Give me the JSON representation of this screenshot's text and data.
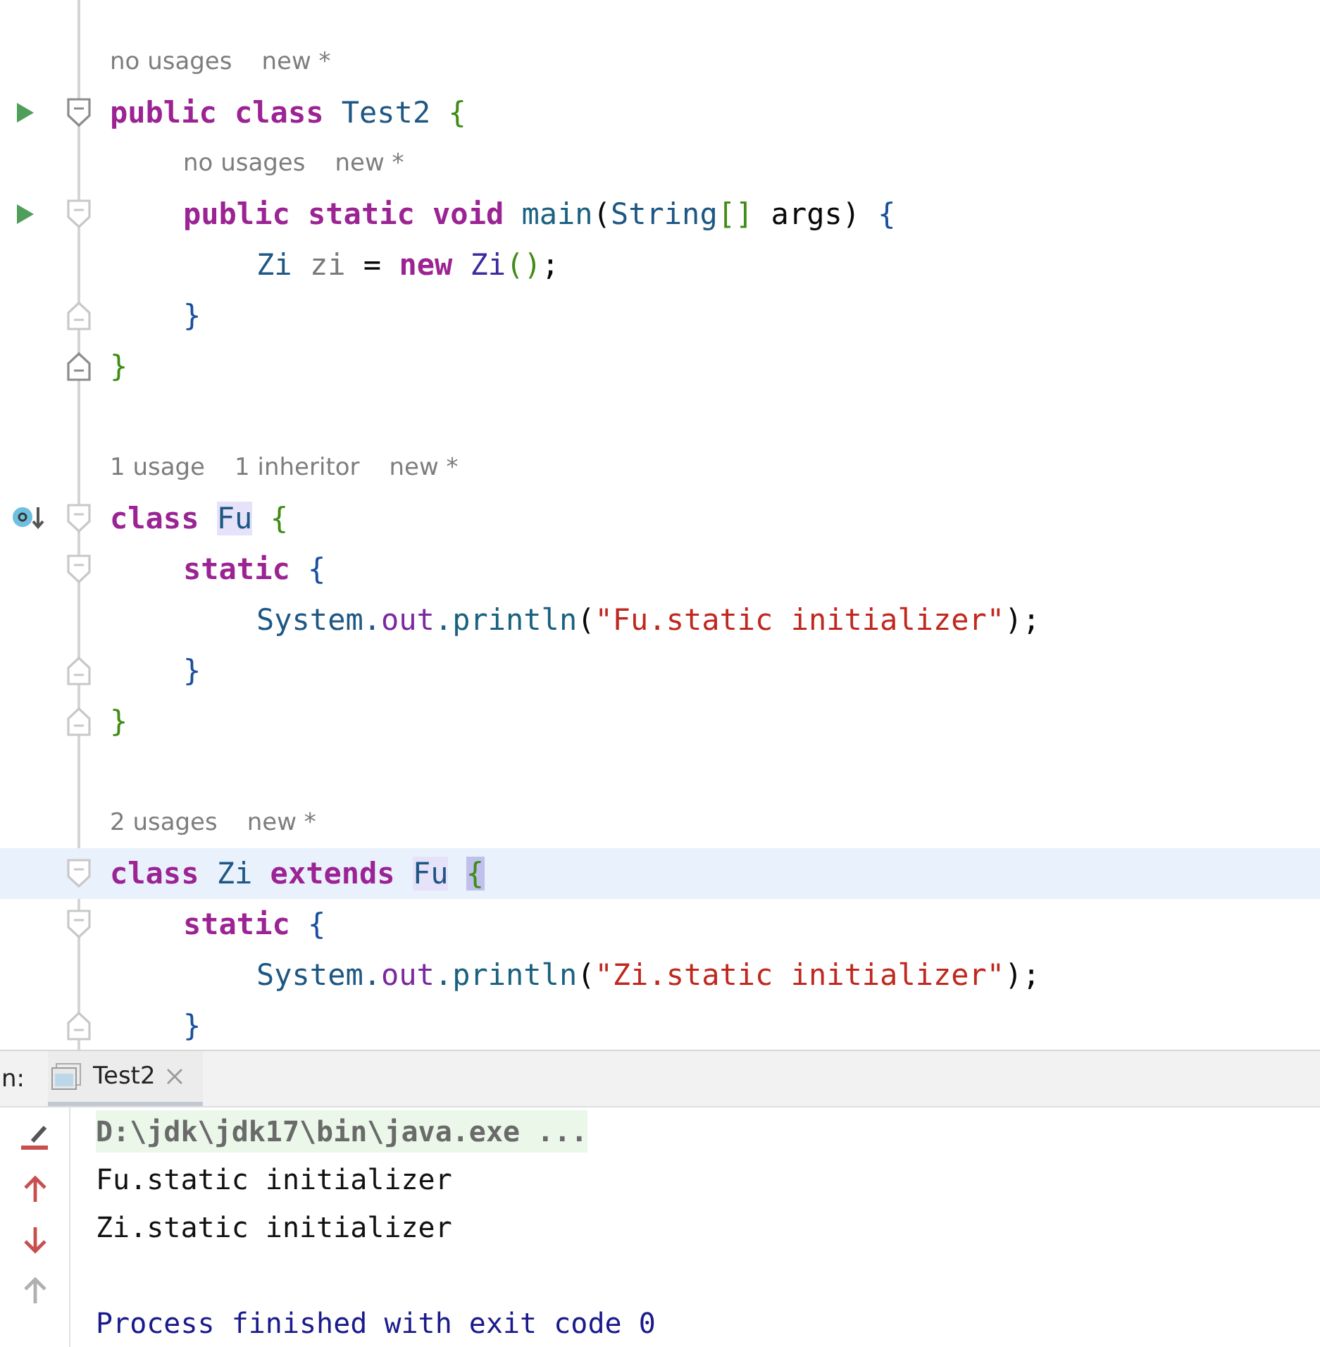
{
  "editor": {
    "items": [
      {
        "kind": "block",
        "hint": [
          "no usages",
          "new *"
        ],
        "runnable": true,
        "implemented": false,
        "current": false,
        "fold_active": true,
        "tokens": [
          {
            "t": "public ",
            "kind": "kw"
          },
          {
            "t": "class ",
            "kind": "kw"
          },
          {
            "t": "Test2 ",
            "kind": "type"
          },
          {
            "t": "{",
            "kind": "brace1"
          }
        ],
        "children": [
          {
            "kind": "block",
            "hint": [
              "no usages",
              "new *"
            ],
            "runnable": true,
            "implemented": false,
            "current": false,
            "fold_active": false,
            "tokens": [
              {
                "t": "public ",
                "kind": "kw"
              },
              {
                "t": "static ",
                "kind": "kw"
              },
              {
                "t": "void ",
                "kind": "kw"
              },
              {
                "t": "main",
                "kind": "method"
              },
              {
                "t": "(",
                "kind": "plain"
              },
              {
                "t": "String",
                "kind": "type"
              },
              {
                "t": "[]",
                "kind": "brace1"
              },
              {
                "t": " args",
                "kind": "plain"
              },
              {
                "t": ") ",
                "kind": "plain"
              },
              {
                "t": "{",
                "kind": "brace2"
              }
            ],
            "children": [
              {
                "kind": "statement",
                "current": false,
                "tokens": [
                  {
                    "t": "Zi ",
                    "kind": "type"
                  },
                  {
                    "t": "zi",
                    "kind": "unused"
                  },
                  {
                    "t": " = ",
                    "kind": "plain"
                  },
                  {
                    "t": "new ",
                    "kind": "kw"
                  },
                  {
                    "t": "Zi",
                    "kind": "type2"
                  },
                  {
                    "t": "(",
                    "kind": "brace1"
                  },
                  {
                    "t": ")",
                    "kind": "brace1"
                  },
                  {
                    "t": ";",
                    "kind": "plain"
                  }
                ]
              }
            ],
            "closer": [
              {
                "t": "}",
                "kind": "brace2"
              }
            ]
          }
        ],
        "closer": [
          {
            "t": "}",
            "kind": "brace1"
          }
        ]
      },
      {
        "kind": "blank"
      },
      {
        "kind": "block",
        "hint": [
          "1 usage",
          "1 inheritor",
          "new *"
        ],
        "runnable": false,
        "implemented": true,
        "current": false,
        "fold_active": false,
        "tokens": [
          {
            "t": "class ",
            "kind": "kw"
          },
          {
            "t": "Fu",
            "kind": "type",
            "usage_highlight": true
          },
          {
            "t": " {",
            "kind": "brace1"
          }
        ],
        "children": [
          {
            "kind": "block",
            "runnable": false,
            "implemented": false,
            "current": false,
            "fold_active": false,
            "tokens": [
              {
                "t": "static ",
                "kind": "kw"
              },
              {
                "t": "{",
                "kind": "brace2"
              }
            ],
            "children": [
              {
                "kind": "statement",
                "current": false,
                "tokens": [
                  {
                    "t": "System.",
                    "kind": "type"
                  },
                  {
                    "t": "out",
                    "kind": "field"
                  },
                  {
                    "t": ".println",
                    "kind": "method"
                  },
                  {
                    "t": "(",
                    "kind": "plain"
                  },
                  {
                    "t": "\"Fu.static initializer\"",
                    "kind": "str"
                  },
                  {
                    "t": ");",
                    "kind": "plain"
                  }
                ]
              }
            ],
            "closer": [
              {
                "t": "}",
                "kind": "brace2"
              }
            ]
          }
        ],
        "closer": [
          {
            "t": "}",
            "kind": "brace1"
          }
        ]
      },
      {
        "kind": "blank"
      },
      {
        "kind": "block",
        "hint": [
          "2 usages",
          "new *"
        ],
        "runnable": false,
        "implemented": false,
        "current": true,
        "fold_active": false,
        "tokens": [
          {
            "t": "class ",
            "kind": "kw"
          },
          {
            "t": "Zi ",
            "kind": "type"
          },
          {
            "t": "extends ",
            "kind": "kw"
          },
          {
            "t": "Fu",
            "kind": "type",
            "usage_highlight": true
          },
          {
            "t": " {",
            "kind": "brace1",
            "caret_match": true
          }
        ],
        "children": [
          {
            "kind": "block",
            "runnable": false,
            "implemented": false,
            "current": false,
            "fold_active": false,
            "tokens": [
              {
                "t": "static ",
                "kind": "kw"
              },
              {
                "t": "{",
                "kind": "brace2"
              }
            ],
            "children": [
              {
                "kind": "statement",
                "current": false,
                "tokens": [
                  {
                    "t": "System.",
                    "kind": "type"
                  },
                  {
                    "t": "out",
                    "kind": "field"
                  },
                  {
                    "t": ".println",
                    "kind": "method"
                  },
                  {
                    "t": "(",
                    "kind": "plain"
                  },
                  {
                    "t": "\"Zi.static initializer\"",
                    "kind": "str"
                  },
                  {
                    "t": ");",
                    "kind": "plain"
                  }
                ]
              }
            ],
            "closer": [
              {
                "t": "}",
                "kind": "brace2"
              }
            ]
          }
        ]
      }
    ]
  },
  "run_panel": {
    "label": "n:",
    "tabs": [
      {
        "title": "Test2",
        "selected": true
      }
    ],
    "toolbar": [
      {
        "kind": "clear",
        "disabled": false
      },
      {
        "kind": "up",
        "disabled": false
      },
      {
        "kind": "down",
        "disabled": false
      },
      {
        "kind": "up",
        "disabled": true
      }
    ],
    "output": [
      {
        "kind": "command",
        "text": "D:\\jdk\\jdk17\\bin\\java.exe ..."
      },
      {
        "kind": "stdout",
        "text": "Fu.static initializer"
      },
      {
        "kind": "stdout",
        "text": "Zi.static initializer"
      },
      {
        "kind": "blank"
      },
      {
        "kind": "system",
        "text": "Process finished with exit code 0"
      }
    ]
  }
}
